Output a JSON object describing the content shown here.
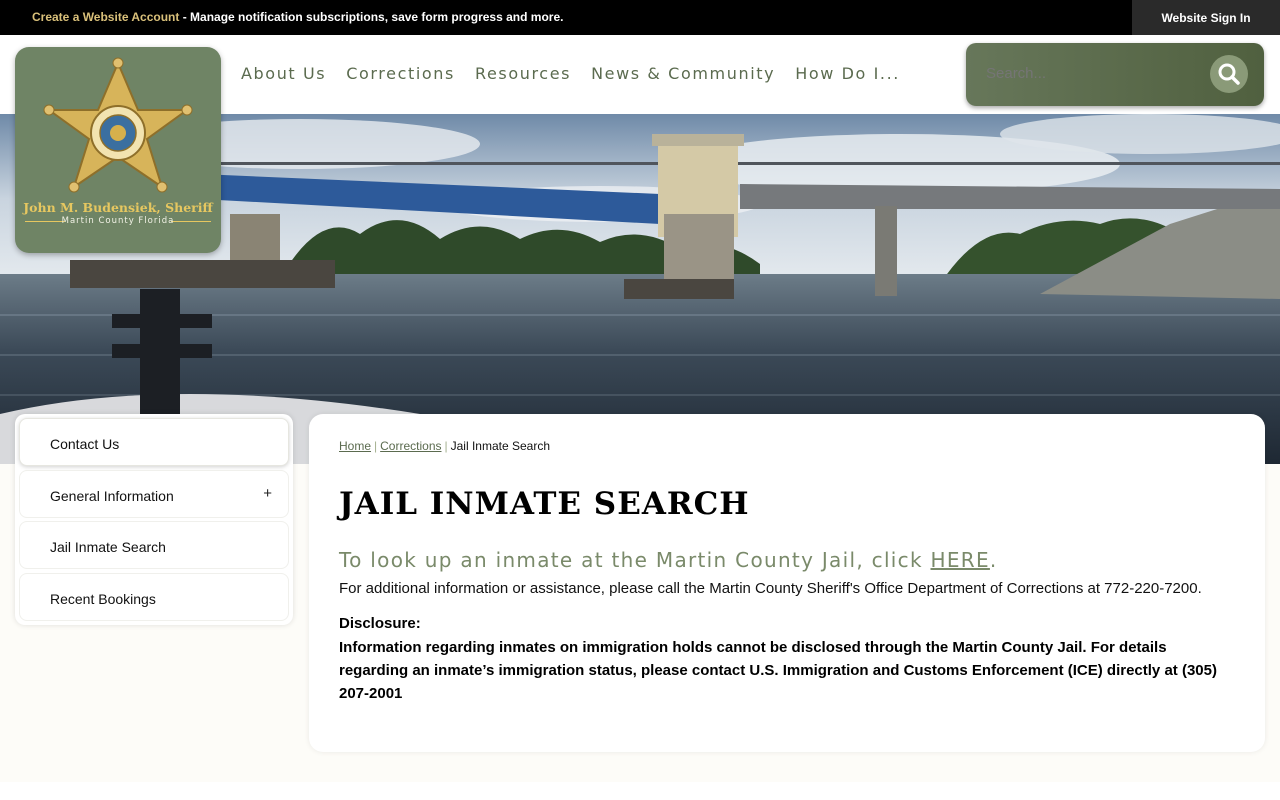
{
  "topbar": {
    "create_account_link": "Create a Website Account",
    "promo_text": " - Manage notification subscriptions, save form progress and more.",
    "signin_label": "Website Sign In"
  },
  "header": {
    "nav": [
      "About Us",
      "Corrections",
      "Resources",
      "News & Community",
      "How Do I..."
    ],
    "search_placeholder": "Search..."
  },
  "logo": {
    "sheriff_name": "John M. Budensiek, Sheriff",
    "county": "Martin County Florida"
  },
  "sidebar": {
    "items": [
      {
        "label": "Contact Us"
      },
      {
        "label": "General Information",
        "expand": "+"
      },
      {
        "label": "Jail Inmate Search"
      },
      {
        "label": "Recent Bookings"
      }
    ]
  },
  "breadcrumb": {
    "home": "Home",
    "corrections": "Corrections",
    "current": "Jail Inmate Search",
    "separator": "|"
  },
  "main": {
    "title": "JAIL INMATE SEARCH",
    "lookup_text": "To look up an inmate at the Martin County Jail, click ",
    "lookup_link": "HERE",
    "lookup_end": ".",
    "info_text": "For additional information or assistance, please call the Martin County Sheriff's Office Department of Corrections at 772-220-7200.",
    "disclosure_heading": "Disclosure:",
    "disclosure_body": "Information regarding inmates on immigration holds cannot be disclosed through the Martin County Jail. For details regarding an inmate’s immigration status, please contact U.S. Immigration and Customs Enforcement (ICE) directly at (305) 207-2001"
  },
  "colors": {
    "brand_green": "#6f8465",
    "nav_text": "#5b6b4f",
    "link_gold": "#d9c07a",
    "star_gold": "#e6c760"
  }
}
